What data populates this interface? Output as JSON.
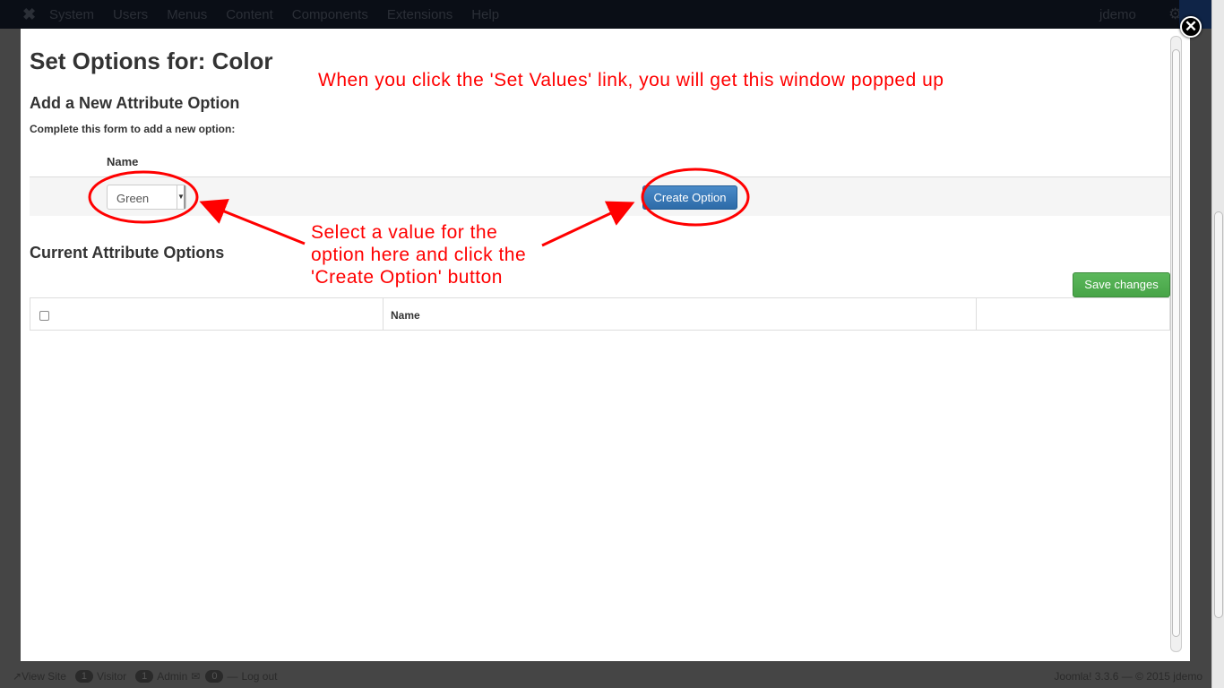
{
  "topnav": {
    "items": [
      "System",
      "Users",
      "Menus",
      "Content",
      "Components",
      "Extensions",
      "Help"
    ],
    "user": "jdemo"
  },
  "modal": {
    "title": "Set Options for: Color",
    "add_heading": "Add a New Attribute Option",
    "add_subtitle": "Complete this form to add a new option:",
    "name_label": "Name",
    "select_value": "Green",
    "create_button": "Create Option",
    "current_heading": "Current Attribute Options",
    "save_button": "Save changes",
    "table_headers": [
      "",
      "Name",
      ""
    ],
    "close": "✕"
  },
  "annotations": {
    "top": "When you click the 'Set Values' link, you will get this window popped up",
    "middle": [
      "Select a value for the",
      "option here and click the",
      "'Create Option' button"
    ],
    "color": "#ff0000"
  },
  "statusbar": {
    "view_site": "View Site",
    "visitor_count": "1",
    "visitor": "Visitor",
    "admin_count": "1",
    "admin": "Admin",
    "msg_count": "0",
    "logout": "Log out",
    "footer": "Joomla! 3.3.6 — © 2015 jdemo"
  }
}
